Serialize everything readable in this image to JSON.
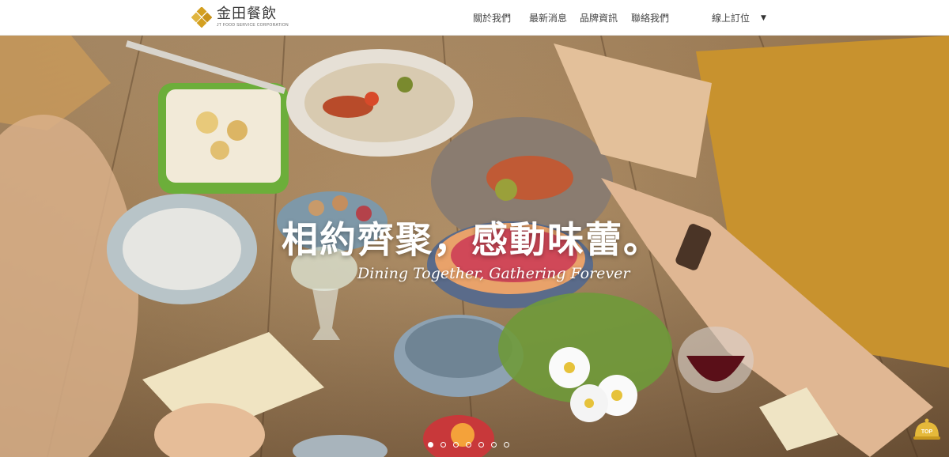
{
  "brand": {
    "name_cn": "金田餐飲",
    "name_en": "JT FOOD SERVICE CORPORATION"
  },
  "nav": [
    {
      "label": "關於我們"
    },
    {
      "label": "最新消息"
    },
    {
      "label": "品牌資訊"
    },
    {
      "label": "聯絡我們"
    }
  ],
  "order": {
    "label": "線上訂位",
    "caret": "▼"
  },
  "hero": {
    "headline": "相約齊聚，感動味蕾。",
    "subline": "Dining Together, Gathering Forever"
  },
  "carousel": {
    "total": 7,
    "active_index": 0
  },
  "back_to_top": {
    "label": "TOP"
  },
  "colors": {
    "brand_gold": "#d4a020",
    "top_button": "#e5b93a"
  }
}
